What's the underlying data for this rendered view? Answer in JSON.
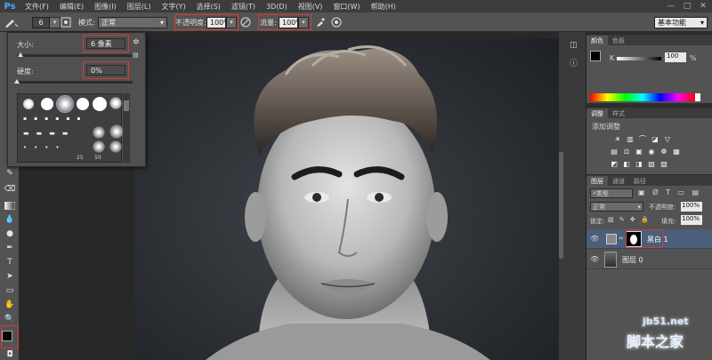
{
  "app": {
    "logo": "Ps"
  },
  "menu": [
    "文件(F)",
    "编辑(E)",
    "图像(I)",
    "图层(L)",
    "文字(Y)",
    "选择(S)",
    "滤镜(T)",
    "3D(D)",
    "视图(V)",
    "窗口(W)",
    "帮助(H)"
  ],
  "window_controls": [
    "—",
    "□",
    "✕"
  ],
  "options": {
    "brush_size": "6",
    "mode_label": "模式:",
    "mode_value": "正常",
    "opacity_label": "不透明度:",
    "opacity_value": "100%",
    "flow_label": "流量:",
    "flow_value": "100%",
    "workspace": "基本功能"
  },
  "brush_popup": {
    "size_label": "大小:",
    "size_value": "6 像素",
    "hardness_label": "硬度:",
    "hardness_value": "0%",
    "size_level": 0.03,
    "hardness_level": 0.0,
    "preset_numbers": [
      "25",
      "50"
    ]
  },
  "color_panel": {
    "tabs": [
      "颜色",
      "色板"
    ],
    "channel": "K",
    "value": "100",
    "unit": "%"
  },
  "adjustments_panel": {
    "tabs": [
      "调整",
      "样式"
    ],
    "title": "添加调整"
  },
  "layers_panel": {
    "tabs": [
      "图层",
      "通道",
      "路径"
    ],
    "kind": "类型",
    "blend_mode": "正常",
    "opacity_label": "不透明度:",
    "opacity_value": "100%",
    "lock_label": "锁定:",
    "fill_label": "填充:",
    "fill_value": "100%",
    "layers": [
      {
        "name": "黑白 1",
        "selected": true
      },
      {
        "name": "图层 0",
        "selected": false
      }
    ]
  },
  "watermark": {
    "url": "jb51.net",
    "text": "脚本之家"
  },
  "colors": {
    "accent_red": "#d23b3b",
    "ps_blue": "#4aa8ff",
    "selected_layer": "#4b5e7a"
  }
}
